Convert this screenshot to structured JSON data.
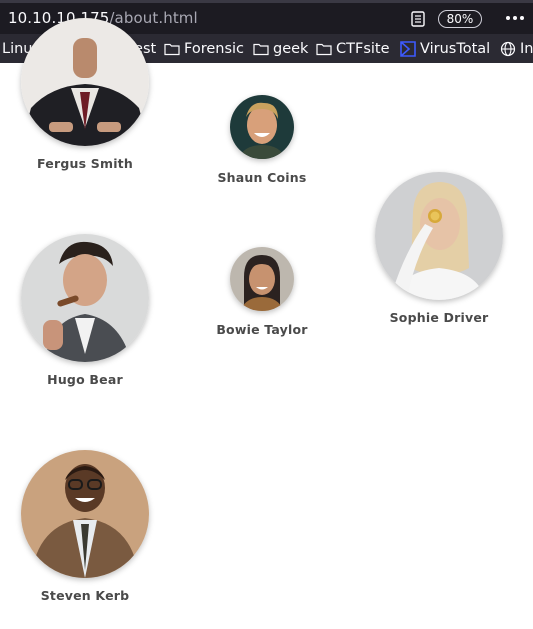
{
  "browser": {
    "url_host": "10.10.10.175",
    "url_path": "/about.html",
    "zoom": "80%"
  },
  "bookmarks": [
    {
      "label": "LinuxBase",
      "icon": "none"
    },
    {
      "label": "Pentest",
      "icon": "folder-icon"
    },
    {
      "label": "Forensic",
      "icon": "folder-icon"
    },
    {
      "label": "geek",
      "icon": "folder-icon"
    },
    {
      "label": "CTFsite",
      "icon": "folder-icon"
    },
    {
      "label": "VirusTotal",
      "icon": "virustotal-icon"
    },
    {
      "label": "In",
      "icon": "globe-icon"
    }
  ],
  "team": {
    "members": [
      {
        "name": "Fergus Smith"
      },
      {
        "name": "Shaun Coins"
      },
      {
        "name": "Sophie Driver"
      },
      {
        "name": "Hugo Bear"
      },
      {
        "name": "Bowie Taylor"
      },
      {
        "name": "Steven Kerb"
      }
    ]
  }
}
